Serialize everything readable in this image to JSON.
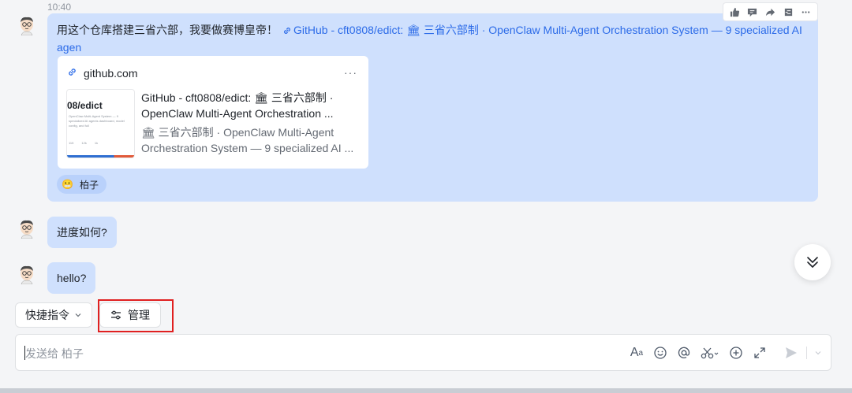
{
  "timestamp": "10:40",
  "message1": {
    "text": "用这个仓库搭建三省六部，我要做赛博皇帝！",
    "link_text": "GitHub - cft0808/edict: 🏛 三省六部制 · OpenClaw Multi-Agent Orchestration System — 9 specialized AI agen",
    "card": {
      "domain": "github.com",
      "more": "···",
      "thumb_title": "08/edict",
      "thumb_lines": "OpenClaw Multi-Agent System — 9 specialized AI agents dashboard, model config, and full",
      "thumb_stats": [
        "115",
        "12k",
        "1k"
      ],
      "title": "GitHub - cft0808/edict: 🏛 三省六部制 · OpenClaw Multi-Agent Orchestration ...",
      "description": "🏛 三省六部制 · OpenClaw Multi-Agent Orchestration System — 9 specialized AI ..."
    },
    "reaction": {
      "emoji": "😬",
      "user": "柏子"
    }
  },
  "message2": {
    "text": "进度如何?"
  },
  "message3": {
    "text": "hello?"
  },
  "toolbar": {
    "icons": [
      "thumbs-up-icon",
      "comment-icon",
      "forward-icon",
      "pin-icon",
      "more-icon"
    ]
  },
  "quick_commands": {
    "label": "快捷指令"
  },
  "manage": {
    "label": "管理"
  },
  "input": {
    "placeholder": "发送给 柏子"
  },
  "colors": {
    "bubble": "#cfe0fd",
    "link": "#2c6be8",
    "highlight": "#e02020"
  }
}
